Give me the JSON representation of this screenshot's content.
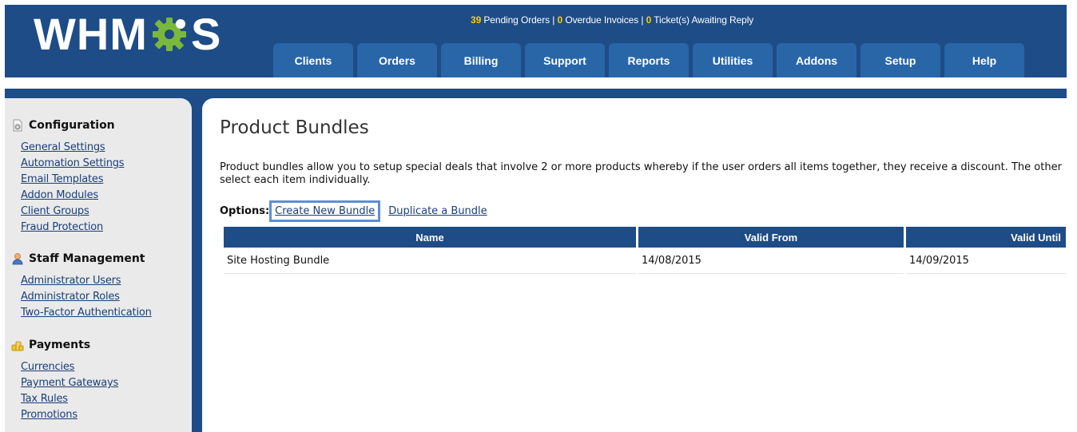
{
  "header": {
    "logo_left": "WHM",
    "logo_right": "S",
    "status": {
      "pending_count": "39",
      "pending_label": " Pending Orders | ",
      "overdue_count": "0",
      "overdue_label": " Overdue Invoices | ",
      "tickets_count": "0",
      "tickets_label": " Ticket(s) Awaiting Reply"
    },
    "nav": [
      "Clients",
      "Orders",
      "Billing",
      "Support",
      "Reports",
      "Utilities",
      "Addons",
      "Setup",
      "Help"
    ]
  },
  "sidebar": {
    "sections": [
      {
        "heading": "Configuration",
        "icon": "gear-document-icon",
        "links": [
          "General Settings",
          "Automation Settings",
          "Email Templates",
          "Addon Modules",
          "Client Groups",
          "Fraud Protection"
        ]
      },
      {
        "heading": "Staff Management",
        "icon": "staff-user-icon",
        "links": [
          "Administrator Users",
          "Administrator Roles",
          "Two-Factor Authentication"
        ]
      },
      {
        "heading": "Payments",
        "icon": "coins-icon",
        "links": [
          "Currencies",
          "Payment Gateways",
          "Tax Rules",
          "Promotions"
        ]
      }
    ]
  },
  "main": {
    "title": "Product Bundles",
    "intro_line1": "Product bundles allow you to setup special deals that involve 2 or more products whereby if the user orders all items together, they receive a discount. The other",
    "intro_line2": "select each item individually.",
    "options_label": "Options:",
    "create_link": "Create New Bundle",
    "duplicate_link": "Duplicate a Bundle",
    "table": {
      "columns": [
        "Name",
        "Valid From",
        "Valid Until"
      ],
      "rows": [
        [
          "Site Hosting Bundle",
          "14/08/2015",
          "14/09/2015"
        ]
      ]
    }
  },
  "colors": {
    "header_blue": "#1e4c86",
    "tab_blue": "#2866a8",
    "status_highlight": "#ffcc00",
    "gear_green": "#7ab83c",
    "link_blue": "#1a3f7a",
    "focus_outline": "#5b8fd6"
  }
}
